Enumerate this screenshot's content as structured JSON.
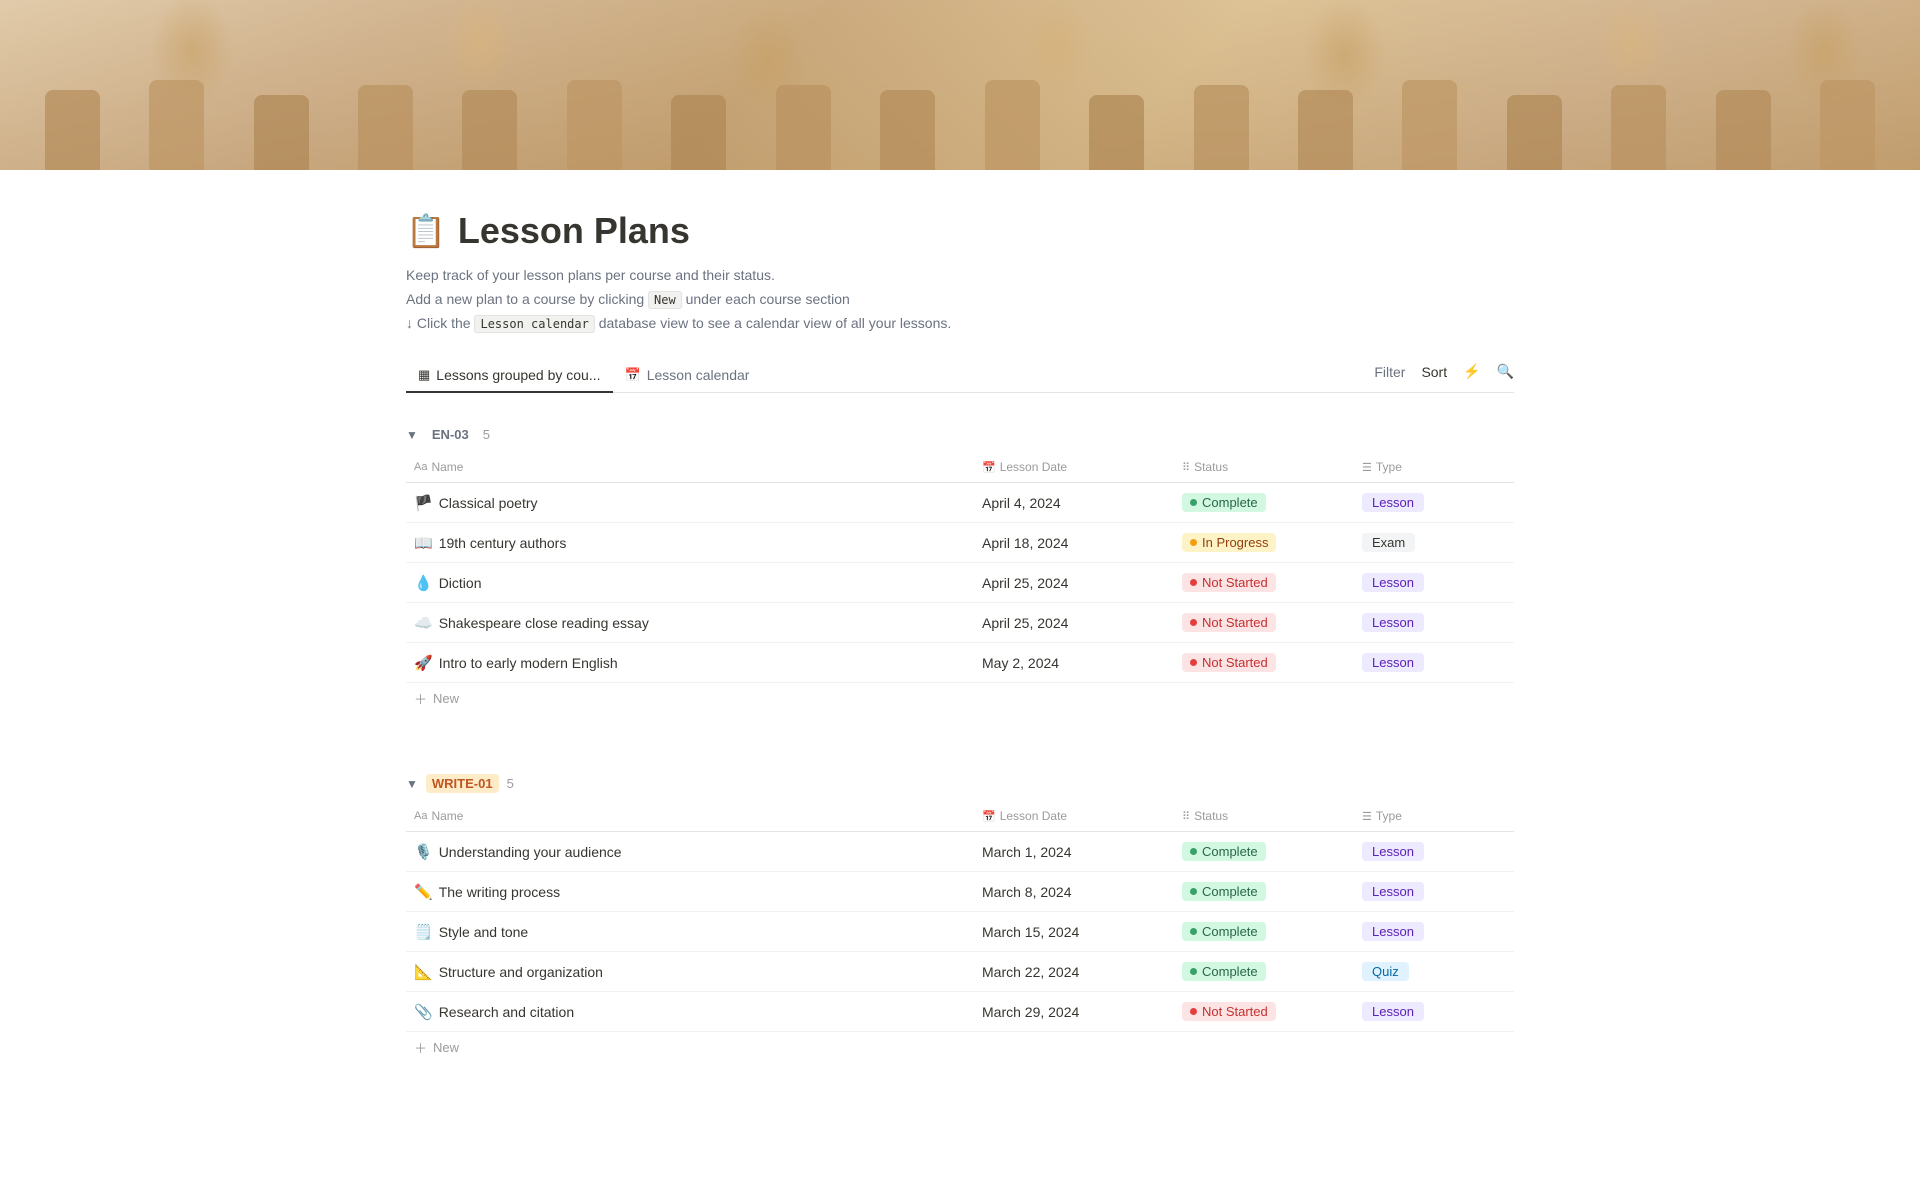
{
  "hero": {
    "alt": "Auditorium seats background"
  },
  "page": {
    "icon": "📋",
    "title": "Lesson Plans",
    "description_line1": "Keep track of your lesson plans per course and their status.",
    "description_line2": "Add a new plan to a course by clicking ",
    "description_new_code": "New",
    "description_line2_end": " under each course section",
    "description_line3_start": "↓ Click the ",
    "description_calendar_code": "Lesson calendar",
    "description_line3_end": " database view to see a calendar view of all your lessons."
  },
  "tabs": [
    {
      "id": "lessons-grouped",
      "icon": "▦",
      "label": "Lessons grouped by cou...",
      "active": true
    },
    {
      "id": "lesson-calendar",
      "icon": "📅",
      "label": "Lesson calendar",
      "active": false
    }
  ],
  "toolbar": {
    "filter_label": "Filter",
    "sort_label": "Sort",
    "lightning_icon": "⚡",
    "search_icon": "🔍"
  },
  "sections": [
    {
      "id": "en03",
      "code": "EN-03",
      "style": "en03",
      "count": 5,
      "columns": [
        {
          "icon": "Aa",
          "label": "Name"
        },
        {
          "icon": "📅",
          "label": "Lesson Date"
        },
        {
          "icon": "⠿",
          "label": "Status"
        },
        {
          "icon": "☰",
          "label": "Type"
        }
      ],
      "rows": [
        {
          "emoji": "🏴",
          "name": "Classical poetry",
          "date": "April 4, 2024",
          "status": "complete",
          "status_label": "Complete",
          "type": "lesson",
          "type_label": "Lesson"
        },
        {
          "emoji": "📖",
          "name": "19th century authors",
          "date": "April 18, 2024",
          "status": "inprogress",
          "status_label": "In Progress",
          "type": "exam",
          "type_label": "Exam"
        },
        {
          "emoji": "💧",
          "name": "Diction",
          "date": "April 25, 2024",
          "status": "notstarted",
          "status_label": "Not Started",
          "type": "lesson",
          "type_label": "Lesson"
        },
        {
          "emoji": "☁️",
          "name": "Shakespeare close reading essay",
          "date": "April 25, 2024",
          "status": "notstarted",
          "status_label": "Not Started",
          "type": "lesson",
          "type_label": "Lesson"
        },
        {
          "emoji": "🚀",
          "name": "Intro to early modern English",
          "date": "May 2, 2024",
          "status": "notstarted",
          "status_label": "Not Started",
          "type": "lesson",
          "type_label": "Lesson"
        }
      ]
    },
    {
      "id": "write01",
      "code": "WRITE-01",
      "style": "write01",
      "count": 5,
      "columns": [
        {
          "icon": "Aa",
          "label": "Name"
        },
        {
          "icon": "📅",
          "label": "Lesson Date"
        },
        {
          "icon": "⠿",
          "label": "Status"
        },
        {
          "icon": "☰",
          "label": "Type"
        }
      ],
      "rows": [
        {
          "emoji": "🎙️",
          "name": "Understanding your audience",
          "date": "March 1, 2024",
          "status": "complete",
          "status_label": "Complete",
          "type": "lesson",
          "type_label": "Lesson"
        },
        {
          "emoji": "✏️",
          "name": "The writing process",
          "date": "March 8, 2024",
          "status": "complete",
          "status_label": "Complete",
          "type": "lesson",
          "type_label": "Lesson"
        },
        {
          "emoji": "🗒️",
          "name": "Style and tone",
          "date": "March 15, 2024",
          "status": "complete",
          "status_label": "Complete",
          "type": "lesson",
          "type_label": "Lesson"
        },
        {
          "emoji": "📐",
          "name": "Structure and organization",
          "date": "March 22, 2024",
          "status": "complete",
          "status_label": "Complete",
          "type": "quiz",
          "type_label": "Quiz"
        },
        {
          "emoji": "📎",
          "name": "Research and citation",
          "date": "March 29, 2024",
          "status": "notstarted",
          "status_label": "Not Started",
          "type": "lesson",
          "type_label": "Lesson"
        }
      ]
    }
  ]
}
